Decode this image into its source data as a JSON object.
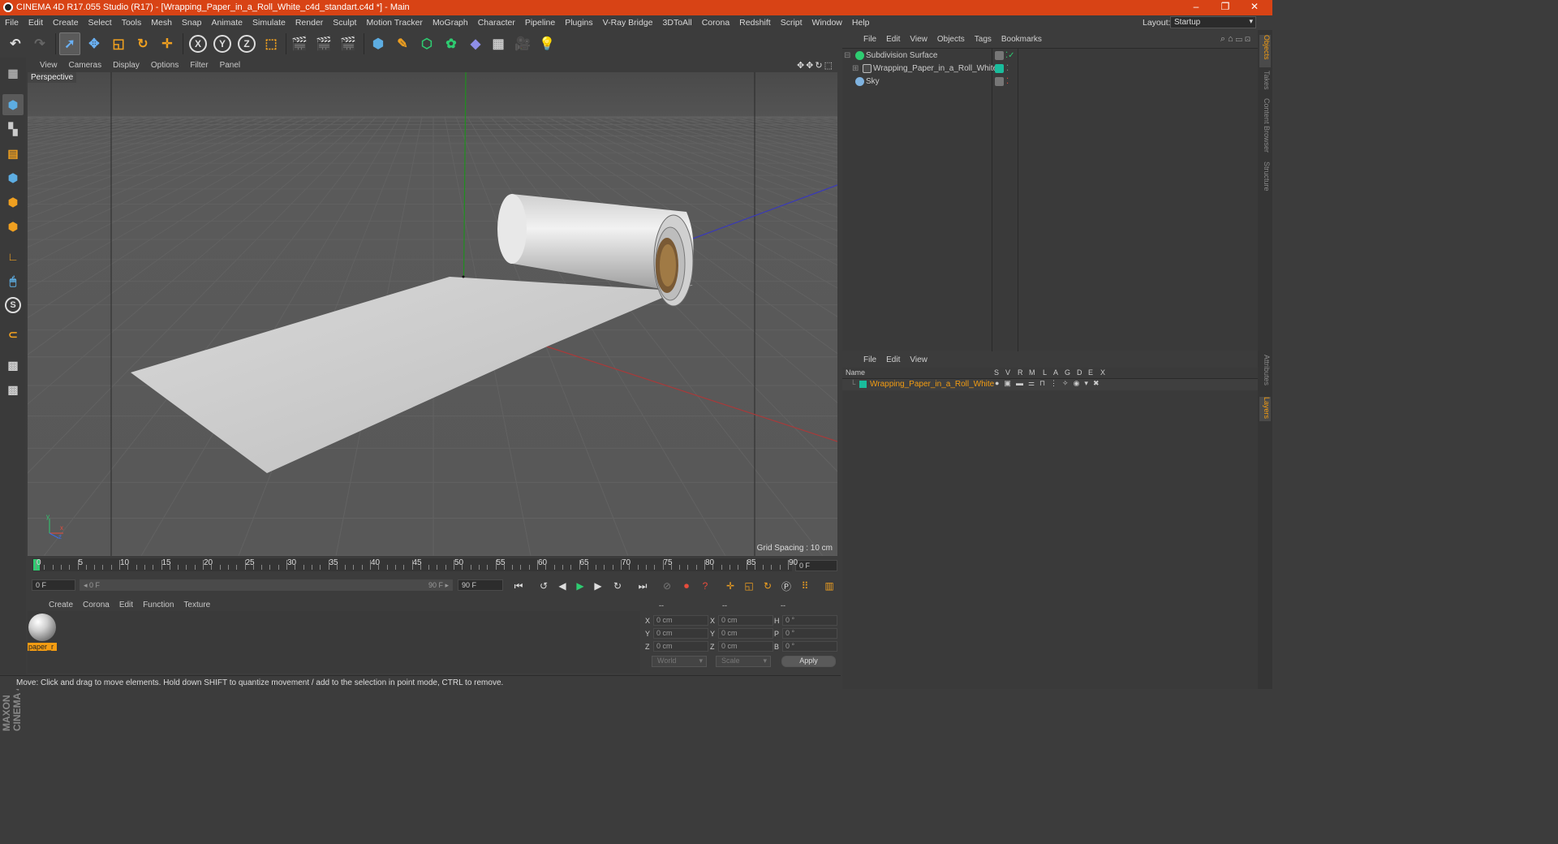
{
  "window": {
    "title": "CINEMA 4D R17.055 Studio (R17) - [Wrapping_Paper_in_a_Roll_White_c4d_standart.c4d *] - Main",
    "controls": [
      "–",
      "❐",
      "✕"
    ]
  },
  "menu": {
    "items": [
      "File",
      "Edit",
      "Create",
      "Select",
      "Tools",
      "Mesh",
      "Snap",
      "Animate",
      "Simulate",
      "Render",
      "Sculpt",
      "Motion Tracker",
      "MoGraph",
      "Character",
      "Pipeline",
      "Plugins",
      "V-Ray Bridge",
      "3DToAll",
      "Corona",
      "Redshift",
      "Script",
      "Window",
      "Help"
    ],
    "layout_label": "Layout:",
    "layout_value": "Startup"
  },
  "toolbar": {
    "axis_x": "X",
    "axis_y": "Y",
    "axis_z": "Z"
  },
  "viewport": {
    "menu": [
      "View",
      "Cameras",
      "Display",
      "Options",
      "Filter",
      "Panel"
    ],
    "label": "Perspective",
    "grid_spacing": "Grid Spacing : 10 cm",
    "axis_y": "y",
    "axis_x": "x",
    "axis_z": "z"
  },
  "timeline": {
    "ticks": [
      "0",
      "5",
      "10",
      "15",
      "20",
      "25",
      "30",
      "35",
      "40",
      "45",
      "50",
      "55",
      "60",
      "65",
      "70",
      "75",
      "80",
      "85",
      "90"
    ],
    "current_frame": "0 F",
    "start_field": "0 F",
    "range_start": "◂ 0 F",
    "range_end": "90 F ▸",
    "end_field": "90 F"
  },
  "material_manager": {
    "menu": [
      "Create",
      "Corona",
      "Edit",
      "Function",
      "Texture"
    ],
    "material_name": "paper_r"
  },
  "coordinates": {
    "headers": [
      "--",
      "--",
      "--"
    ],
    "rows": [
      {
        "l1": "X",
        "v1": "0 cm",
        "l2": "X",
        "v2": "0 cm",
        "l3": "H",
        "v3": "0 °"
      },
      {
        "l1": "Y",
        "v1": "0 cm",
        "l2": "Y",
        "v2": "0 cm",
        "l3": "P",
        "v3": "0 °"
      },
      {
        "l1": "Z",
        "v1": "0 cm",
        "l2": "Z",
        "v2": "0 cm",
        "l3": "B",
        "v3": "0 °"
      }
    ],
    "space": "World",
    "mode": "Scale",
    "apply": "Apply"
  },
  "status": {
    "text": "Move: Click and drag to move elements. Hold down SHIFT to quantize movement / add to the selection in point mode, CTRL to remove."
  },
  "object_manager": {
    "menu": [
      "File",
      "Edit",
      "View",
      "Objects",
      "Tags",
      "Bookmarks"
    ],
    "objects": [
      {
        "name": "Subdivision Surface"
      },
      {
        "name": "Wrapping_Paper_in_a_Roll_White"
      },
      {
        "name": "Sky"
      }
    ]
  },
  "layer_manager": {
    "menu": [
      "File",
      "Edit",
      "View"
    ],
    "columns": [
      "Name",
      "S",
      "V",
      "R",
      "M",
      "L",
      "A",
      "G",
      "D",
      "E",
      "X"
    ],
    "layer_name": "Wrapping_Paper_in_a_Roll_White"
  },
  "side_tabs": [
    "Objects",
    "Takes",
    "Content Browser",
    "Structure",
    "Attributes",
    "Layers"
  ],
  "colors": {
    "title_bar": "#d84315",
    "accent_orange": "#f39c12",
    "layer_green": "#1abc9c"
  }
}
